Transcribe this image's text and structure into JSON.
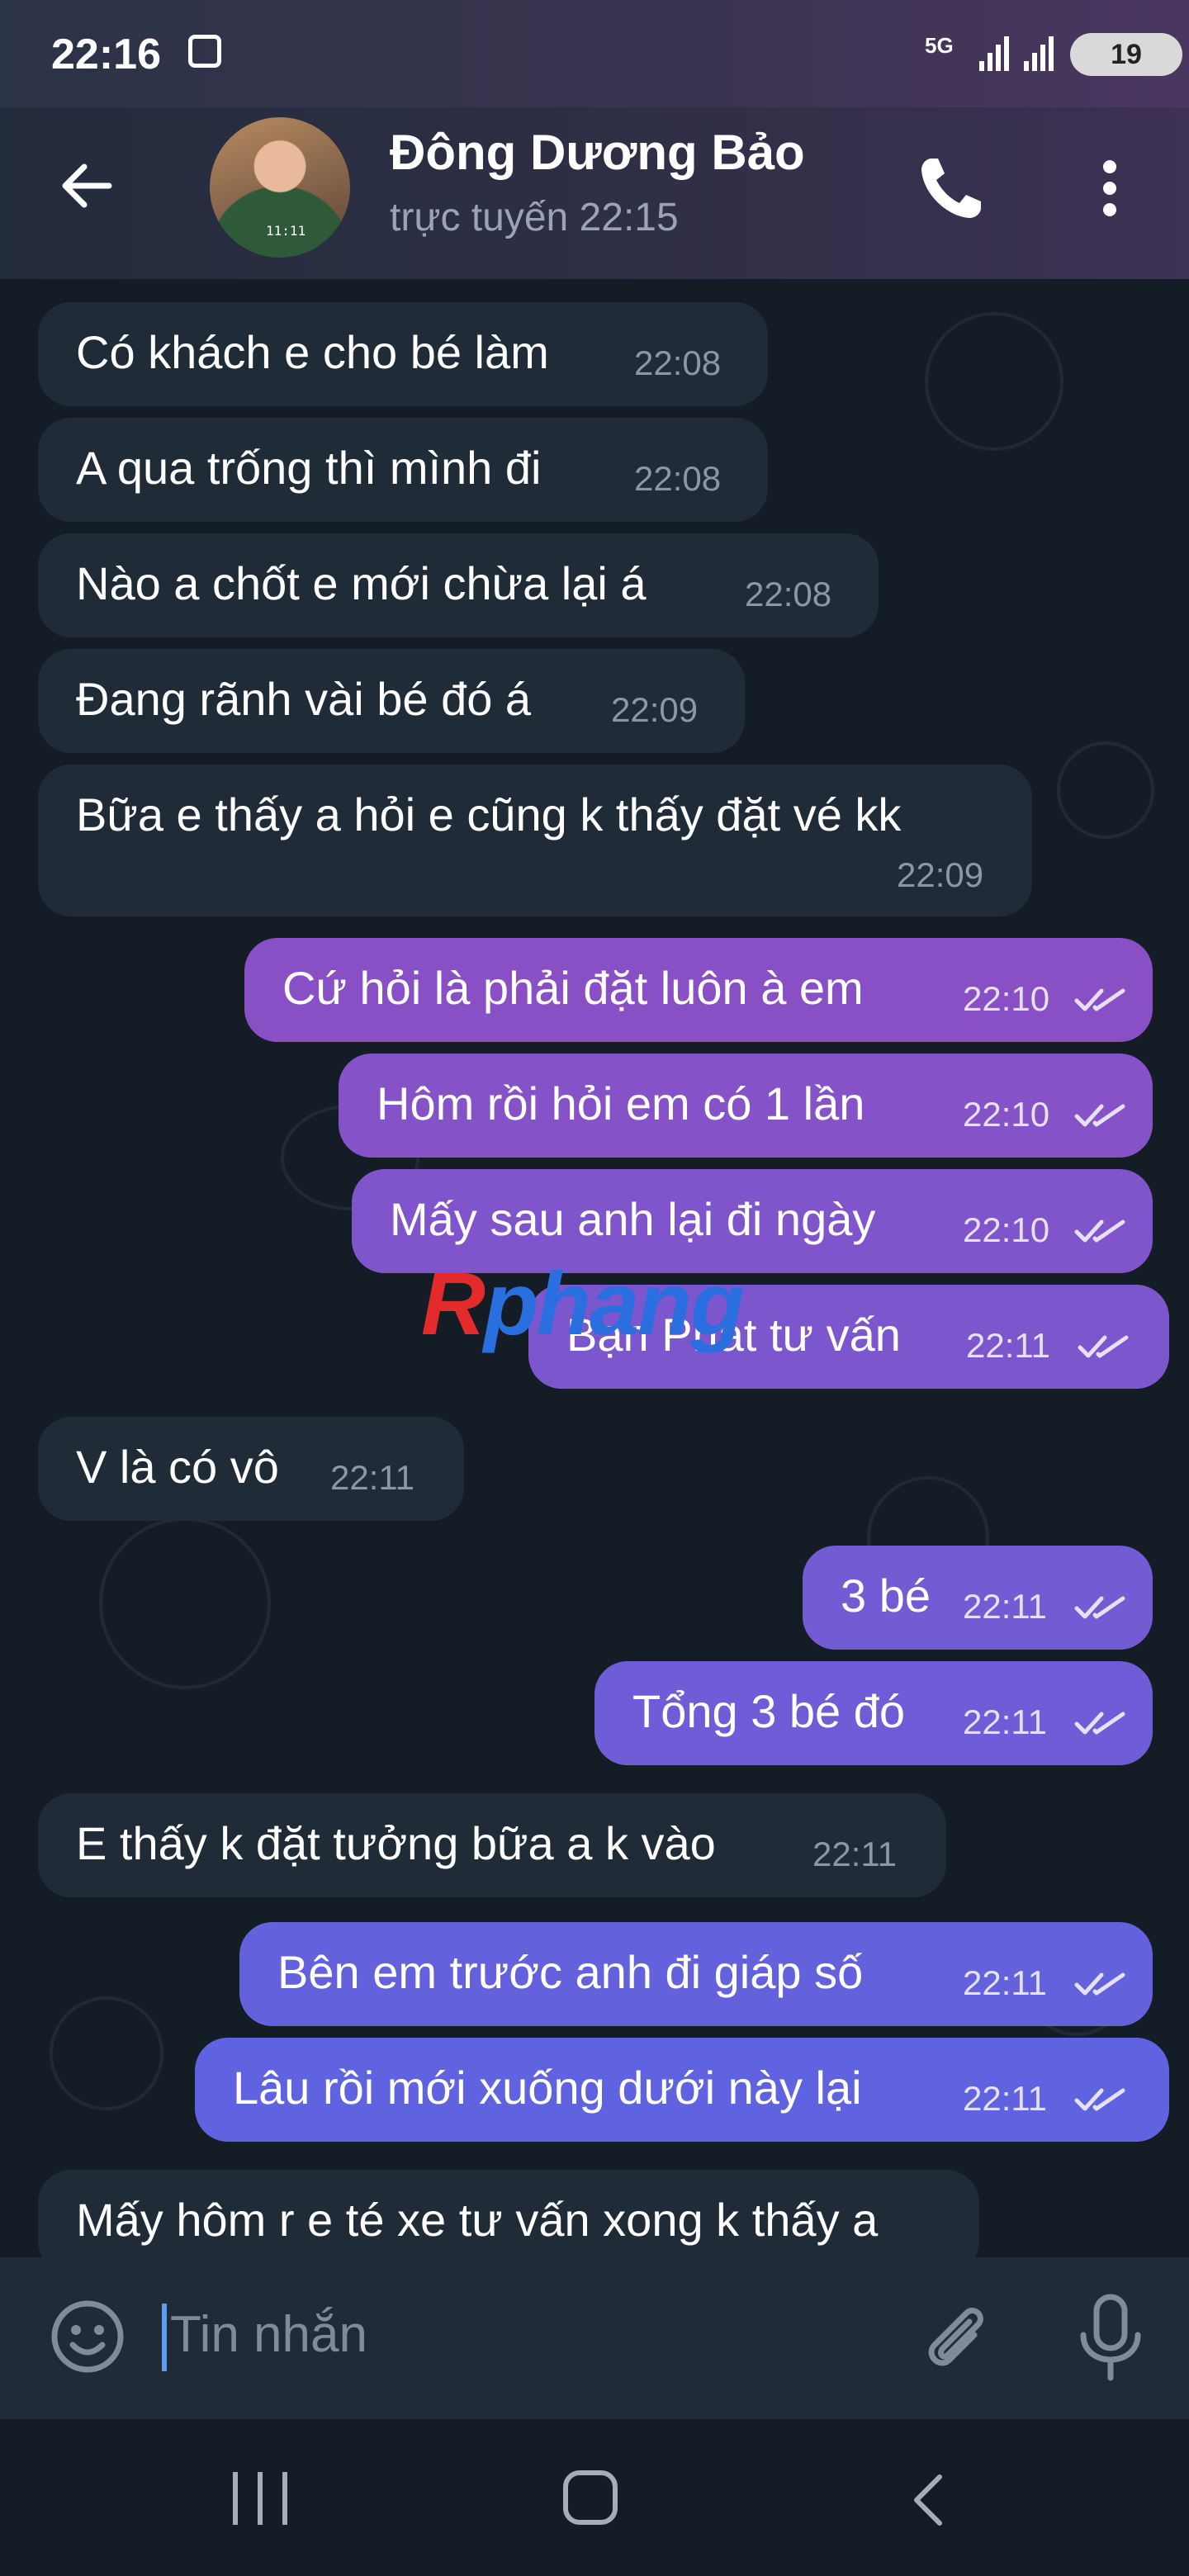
{
  "status_bar": {
    "time": "22:16",
    "network": "5G",
    "battery": "19"
  },
  "header": {
    "contact_name": "Đông Dương Bảo",
    "presence": "trực tuyến 22:15",
    "avatar_shirt_text": "11:11"
  },
  "colors": {
    "chat_background": "#141d26",
    "incoming_bubble": "#202b38",
    "outgoing_top": "#8b4fc4",
    "outgoing_bottom": "#5e64e0",
    "accent_cursor": "#5e9cf0"
  },
  "messages": [
    {
      "dir": "in",
      "text": "Có khách e cho bé làm",
      "time": "22:08"
    },
    {
      "dir": "in",
      "text": "A qua trống thì mình đi",
      "time": "22:08"
    },
    {
      "dir": "in",
      "text": "Nào a chốt e mới chừa lại á",
      "time": "22:08"
    },
    {
      "dir": "in",
      "text": "Đang rãnh vài bé đó á",
      "time": "22:09"
    },
    {
      "dir": "in",
      "text": "Bữa e thấy a hỏi e cũng k thấy đặt vé kk",
      "time": "22:09"
    },
    {
      "dir": "out",
      "text": "Cứ hỏi là phải đặt luôn à em",
      "time": "22:10"
    },
    {
      "dir": "out",
      "text": "Hôm rồi hỏi em có 1 lần",
      "time": "22:10"
    },
    {
      "dir": "out",
      "text": "Mấy sau anh lại đi ngày",
      "time": "22:10"
    },
    {
      "dir": "out",
      "text": "Bạn Phát tư vấn",
      "time": "22:11"
    },
    {
      "dir": "in",
      "text": "V là có vô",
      "time": "22:11"
    },
    {
      "dir": "out",
      "text": "3 bé",
      "time": "22:11"
    },
    {
      "dir": "out",
      "text": "Tổng 3 bé đó",
      "time": "22:11"
    },
    {
      "dir": "in",
      "text": "E thấy k đặt tưởng bữa a k vào",
      "time": "22:11"
    },
    {
      "dir": "out",
      "text": "Bên em trước anh đi giáp số",
      "time": "22:11"
    },
    {
      "dir": "out",
      "text": "Lâu rồi mới xuống dưới này lại",
      "time": "22:11"
    },
    {
      "dir": "in",
      "text": "Mấy hôm r e té xe tư vấn xong k thấy a",
      "time": ""
    }
  ],
  "watermark": {
    "part1": "R",
    "part2": "phang"
  },
  "input": {
    "placeholder": "Tin nhắn"
  },
  "icons": {
    "back": "arrow-left-icon",
    "call": "phone-icon",
    "more": "more-vertical-icon",
    "emoji": "emoji-icon",
    "attach": "paperclip-icon",
    "mic": "microphone-icon",
    "read": "double-check-icon",
    "scroll": "chevron-down-icon"
  }
}
